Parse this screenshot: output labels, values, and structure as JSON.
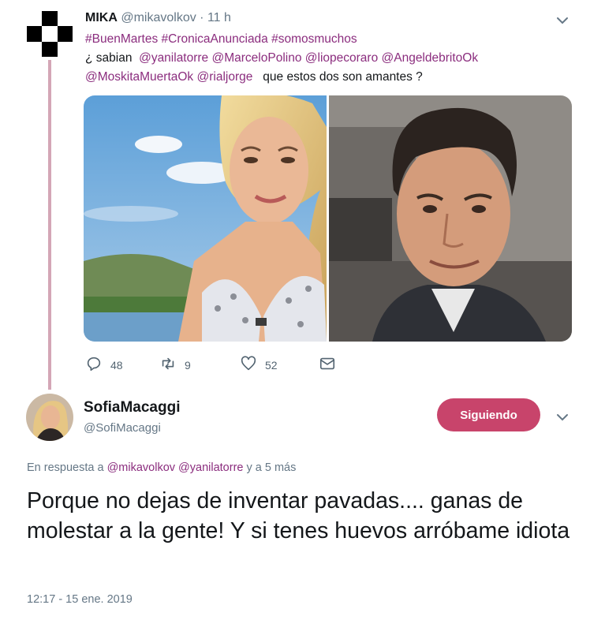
{
  "tweet": {
    "author_name": "MIKA",
    "author_handle": "@mikavolkov",
    "time": "· 11 h",
    "hashtags": [
      "#BuenMartes",
      "#CronicaAnunciada",
      "#somosmuchos"
    ],
    "text_intro": "¿ sabian",
    "mentions": [
      "@yanilatorre",
      "@MarceloPolino",
      "@liopecoraro",
      "@AngeldebritoOk",
      "@MoskitaMuertaOk",
      "@rialjorge"
    ],
    "text_end": "que estos dos son amantes ?",
    "replies": "48",
    "retweets": "9",
    "likes": "52"
  },
  "reply": {
    "author_name": "SofiaMacaggi",
    "author_handle": "@SofiMacaggi",
    "follow_label": "Siguiendo",
    "reply_prefix": "En respuesta a",
    "reply_user1": "@mikavolkov",
    "reply_user2": "@yanilatorre",
    "reply_suffix": "y a 5 más",
    "body": "Porque no dejas de inventar pavadas.... ganas de molestar a la gente! Y si tenes huevos arróbame idiota",
    "timestamp": "12:17 - 15 ene. 2019"
  },
  "icons": {
    "caret": "chevron-down-icon",
    "reply": "reply-icon",
    "retweet": "retweet-icon",
    "like": "heart-icon",
    "dm": "envelope-icon"
  },
  "colors": {
    "link": "#8b2d7e",
    "follow_button": "#c8446b",
    "thread_line": "#d4a6b6",
    "muted": "#657786"
  }
}
